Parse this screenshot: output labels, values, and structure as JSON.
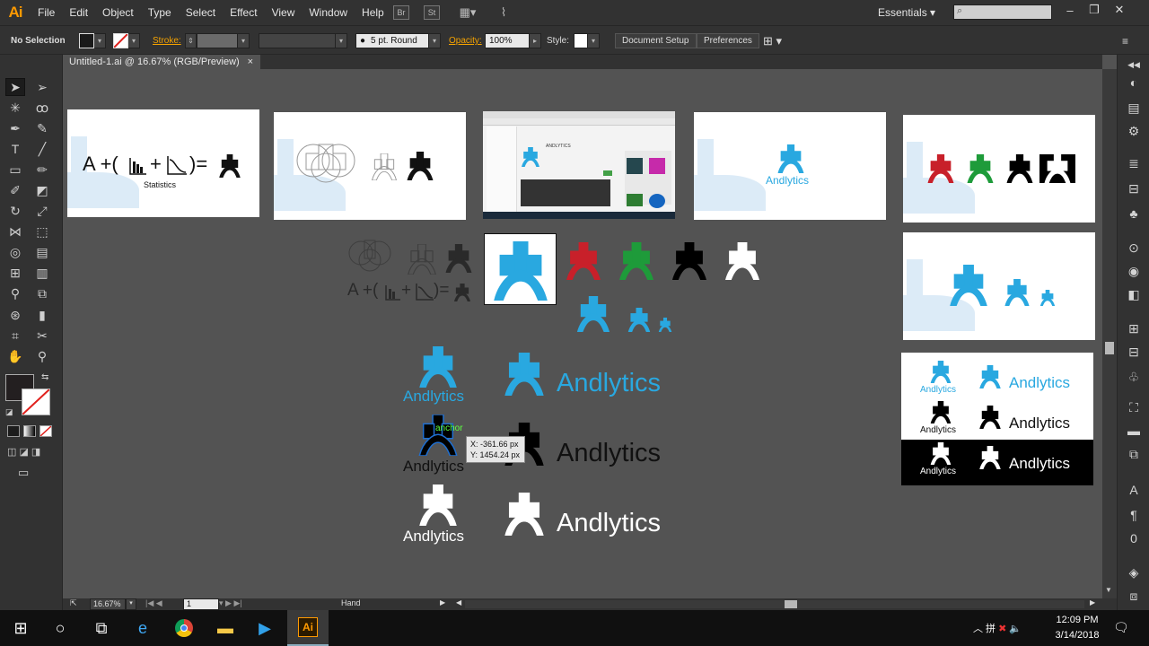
{
  "app": {
    "logo": "Ai"
  },
  "menu": [
    "File",
    "Edit",
    "Object",
    "Type",
    "Select",
    "Effect",
    "View",
    "Window",
    "Help"
  ],
  "menubar": {
    "br_btn": "Br",
    "st_btn": "St",
    "workspace": "Essentials"
  },
  "control": {
    "selection": "No Selection",
    "stroke_label": "Stroke:",
    "brush": "5 pt. Round",
    "opacity_label": "Opacity:",
    "opacity": "100%",
    "style_label": "Style:",
    "doc_setup": "Document Setup",
    "preferences": "Preferences"
  },
  "doc_tab": {
    "title": "Untitled-1.ai @ 16.67% (RGB/Preview)",
    "close": "×"
  },
  "artwork": {
    "formula1": "A +(",
    "formula2": "+",
    "formula3": ")=",
    "statistics": "Statistics",
    "brand": "Andlytics",
    "anchor": "anchor",
    "store_title": "ANDLYTICS"
  },
  "tooltip": {
    "x": "X: -361.66 px",
    "y": "Y: 1454.24 px"
  },
  "status": {
    "zoom": "16.67%",
    "page": "1",
    "tool": "Hand"
  },
  "taskbar": {
    "time": "12:09 PM",
    "date": "3/14/2018"
  },
  "colors": {
    "brand_blue": "#29a8e0",
    "red": "#c8202a",
    "green": "#1e9b3a",
    "black": "#000000"
  }
}
